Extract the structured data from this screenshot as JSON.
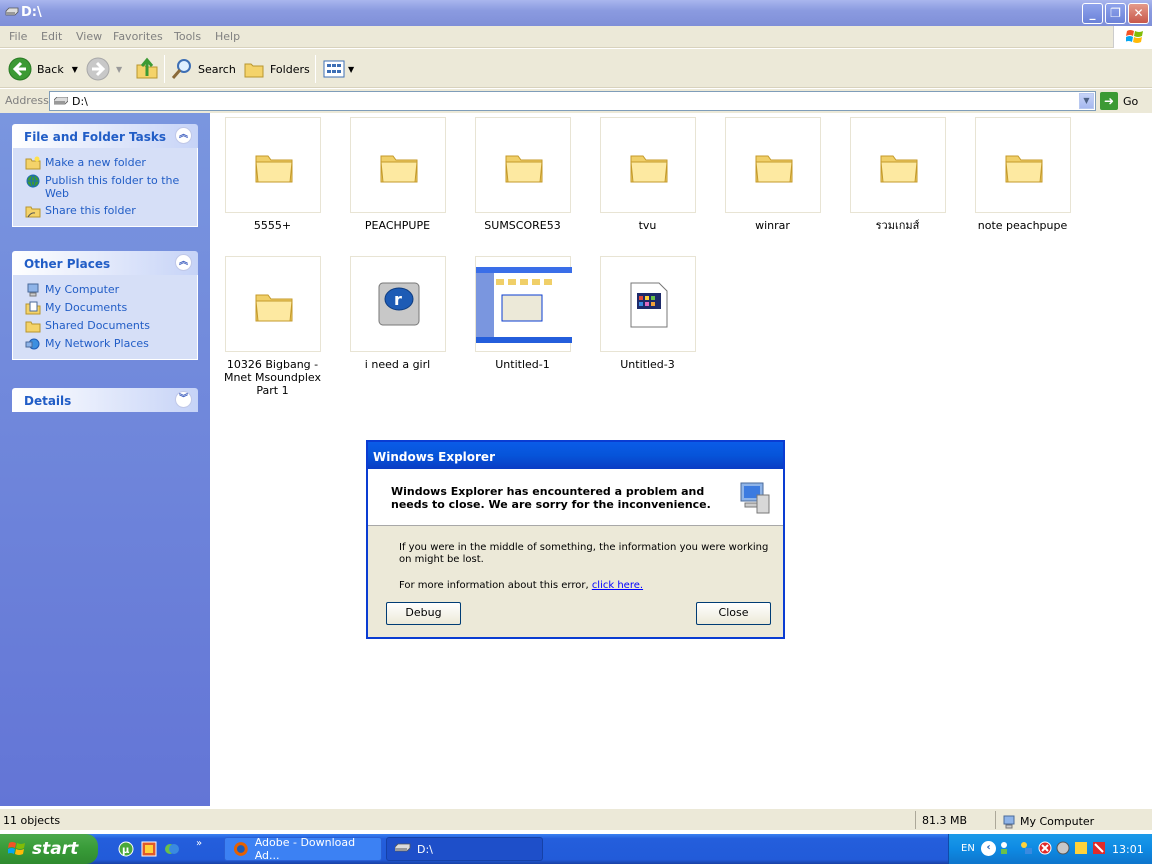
{
  "window": {
    "title": "D:\\",
    "menu": [
      "File",
      "Edit",
      "View",
      "Favorites",
      "Tools",
      "Help"
    ]
  },
  "toolbar": {
    "back_label": "Back",
    "search_label": "Search",
    "folders_label": "Folders"
  },
  "address": {
    "label": "Address",
    "value": "D:\\",
    "go_label": "Go"
  },
  "sidebar": {
    "file_tasks": {
      "title": "File and Folder Tasks",
      "items": [
        "Make a new folder",
        "Publish this folder to the Web",
        "Share this folder"
      ]
    },
    "other_places": {
      "title": "Other Places",
      "items": [
        "My Computer",
        "My Documents",
        "Shared Documents",
        "My Network Places"
      ]
    },
    "details": {
      "title": "Details"
    }
  },
  "items": [
    {
      "name": "5555+",
      "type": "folder"
    },
    {
      "name": "PEACHPUPE",
      "type": "folder"
    },
    {
      "name": "SUMSCORE53",
      "type": "folder"
    },
    {
      "name": "tvu",
      "type": "folder"
    },
    {
      "name": "winrar",
      "type": "folder"
    },
    {
      "name": "รวมเกมส์",
      "type": "folder"
    },
    {
      "name": "note peachpupe",
      "type": "folder"
    },
    {
      "name": "10326 Bigbang - Mnet Msoundplex Part 1",
      "type": "folder"
    },
    {
      "name": "i need a girl",
      "type": "realplayer"
    },
    {
      "name": "Untitled-1",
      "type": "screenshot"
    },
    {
      "name": "Untitled-3",
      "type": "document"
    }
  ],
  "dialog": {
    "title": "Windows Explorer",
    "message": "Windows Explorer has encountered a problem and needs to close.  We are sorry for the inconvenience.",
    "body": "If you were in the middle of something, the information you were working on might be lost.",
    "more_info": "For more information about this error, ",
    "link": "click here.",
    "debug_label": "Debug",
    "close_label": "Close"
  },
  "status": {
    "objects": "11 objects",
    "size": "81.3 MB",
    "location": "My Computer"
  },
  "taskbar": {
    "start_label": "start",
    "tasks": [
      "Adobe - Download Ad...",
      "D:\\"
    ],
    "lang": "EN",
    "clock": "13:01"
  },
  "colors": {
    "sidebar_link": "#215dc6",
    "dialog_title": "#0a5ce8",
    "taskbar": "#245edc",
    "start_green": "#389b38"
  }
}
